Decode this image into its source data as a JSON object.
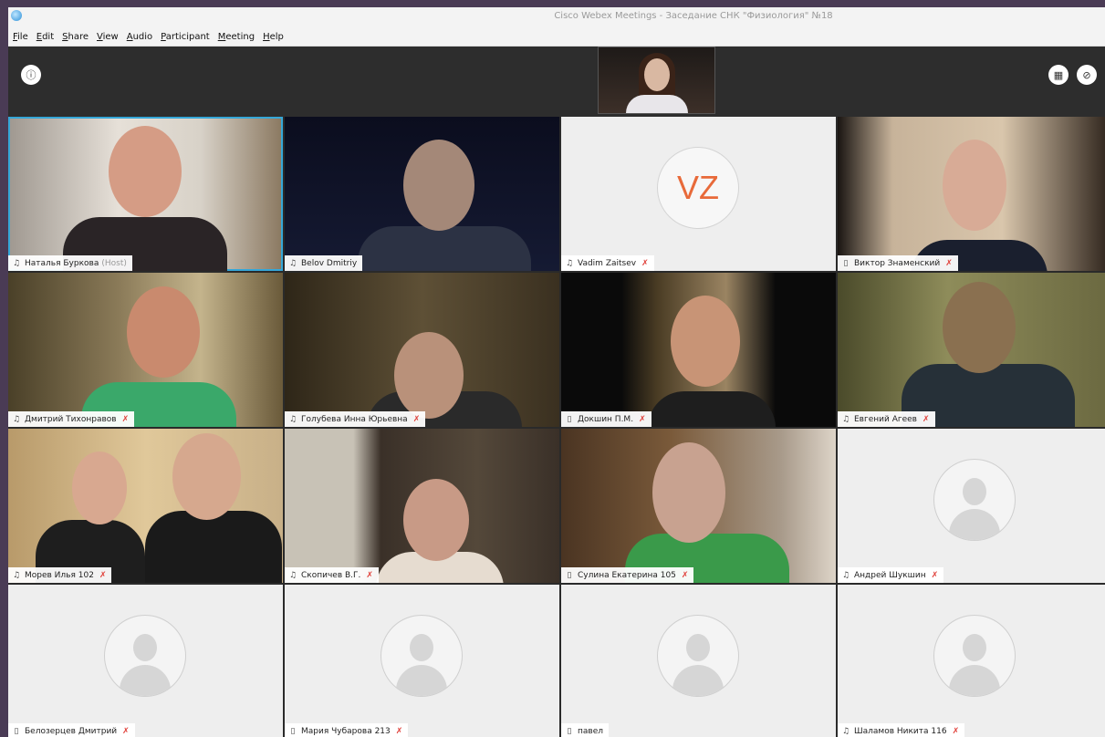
{
  "window": {
    "title": "Cisco Webex Meetings - Заседание СНК \"Физиология\" №18"
  },
  "menu": [
    {
      "label": "File",
      "key": "F",
      "rest": "ile"
    },
    {
      "label": "Edit",
      "key": "E",
      "rest": "dit"
    },
    {
      "label": "Share",
      "key": "S",
      "rest": "hare"
    },
    {
      "label": "View",
      "key": "V",
      "rest": "iew"
    },
    {
      "label": "Audio",
      "key": "A",
      "rest": "udio"
    },
    {
      "label": "Participant",
      "key": "P",
      "rest": "articipant"
    },
    {
      "label": "Meeting",
      "key": "M",
      "rest": "eeting"
    },
    {
      "label": "Help",
      "key": "H",
      "rest": "elp"
    }
  ],
  "host_tag": "(Host)",
  "participants": [
    {
      "name": "Наталья Буркова",
      "device": "headset-icon",
      "muted": false,
      "host": true
    },
    {
      "name": "Belov Dmitriy",
      "device": "headset-icon",
      "muted": false,
      "host": false
    },
    {
      "name": "Vadim Zaitsev",
      "device": "headset-icon",
      "muted": true,
      "host": false,
      "initials": "VZ"
    },
    {
      "name": "Виктор Знаменский",
      "device": "phone-icon",
      "muted": true,
      "host": false
    },
    {
      "name": "Дмитрий Тихонравов",
      "device": "headset-icon",
      "muted": true,
      "host": false
    },
    {
      "name": "Голубева Инна Юрьевна",
      "device": "headset-icon",
      "muted": true,
      "host": false
    },
    {
      "name": "Докшин П.М.",
      "device": "phone-icon",
      "muted": true,
      "host": false
    },
    {
      "name": "Евгений Агеев",
      "device": "headset-icon",
      "muted": true,
      "host": false
    },
    {
      "name": "Морев Илья 102",
      "device": "headset-icon",
      "muted": true,
      "host": false
    },
    {
      "name": "Скопичев В.Г.",
      "device": "headset-icon",
      "muted": true,
      "host": false
    },
    {
      "name": "Сулина Екатерина 105",
      "device": "phone-icon",
      "muted": true,
      "host": false
    },
    {
      "name": "Андрей Шукшин",
      "device": "headset-icon",
      "muted": true,
      "host": false
    },
    {
      "name": "Белозерцев Дмитрий",
      "device": "phone-icon",
      "muted": true,
      "host": false
    },
    {
      "name": "Мария Чубарова 213",
      "device": "phone-icon",
      "muted": true,
      "host": false
    },
    {
      "name": "павел",
      "device": "phone-icon",
      "muted": false,
      "host": false
    },
    {
      "name": "Шаламов Никита 116",
      "device": "headset-icon",
      "muted": true,
      "host": false
    }
  ],
  "colors": {
    "active_border": "#35a7d8",
    "mute": "#e0403a",
    "initials": "#e86a3a"
  }
}
